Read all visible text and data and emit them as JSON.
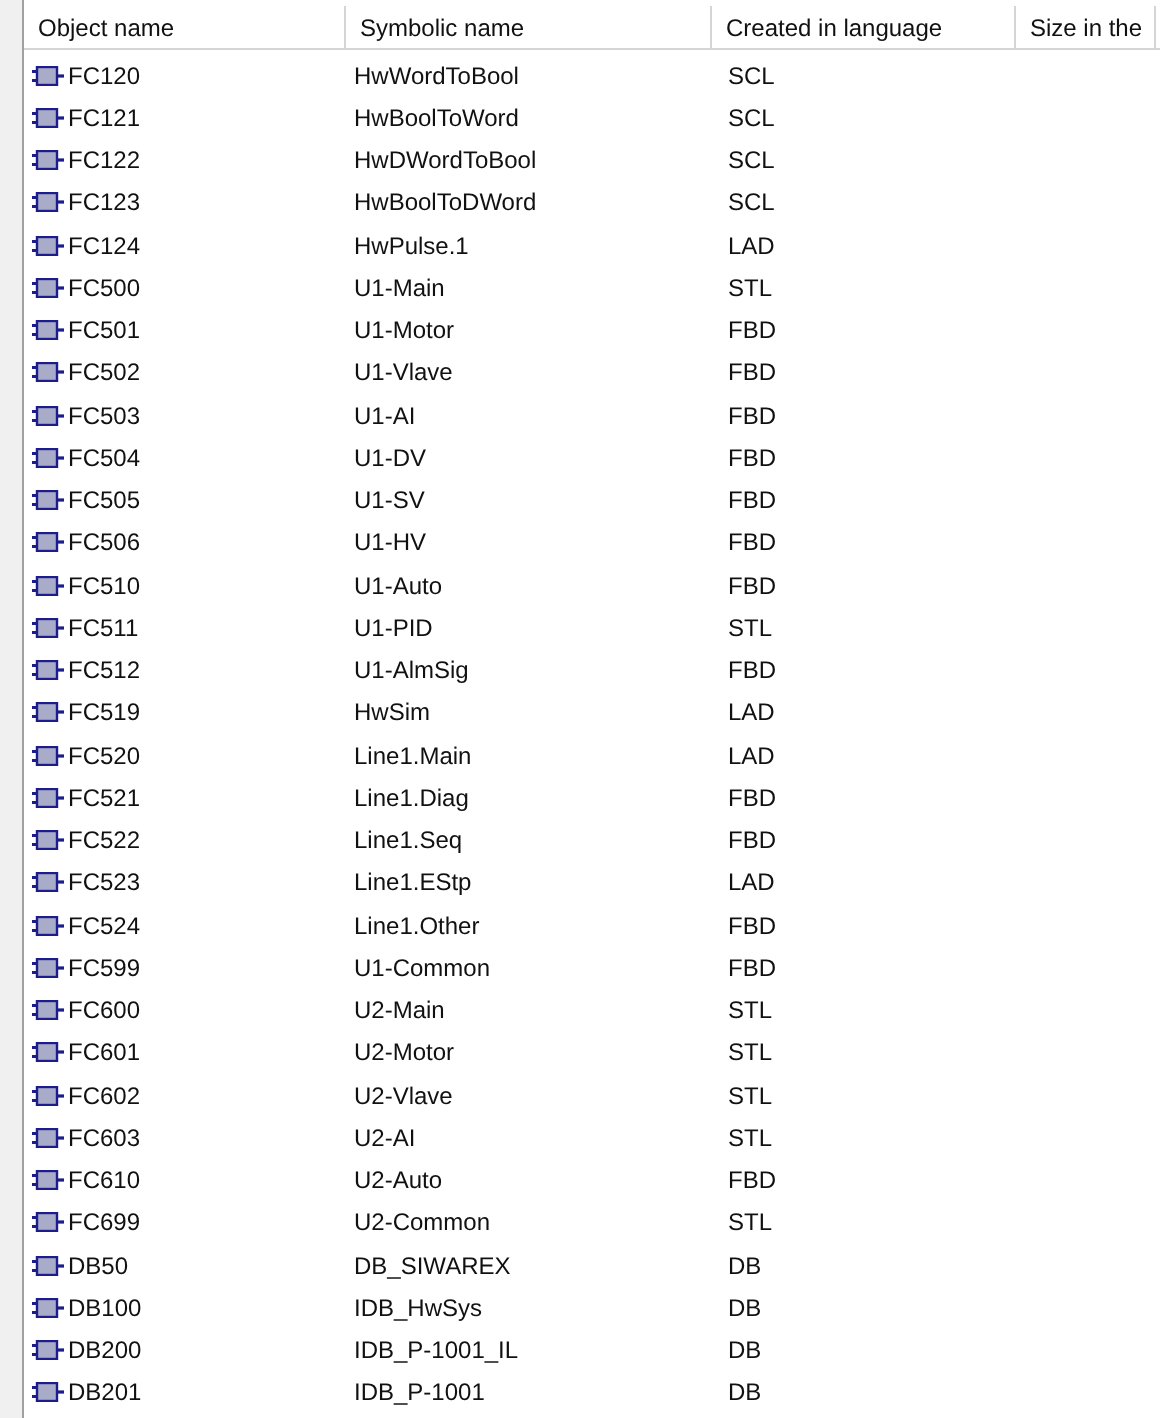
{
  "table": {
    "columns": [
      "Object name",
      "Symbolic name",
      "Created in language",
      "Size in the"
    ],
    "rows": [
      {
        "object_name": "FC120",
        "symbolic_name": "HwWordToBool",
        "language": "SCL"
      },
      {
        "object_name": "FC121",
        "symbolic_name": "HwBoolToWord",
        "language": "SCL"
      },
      {
        "object_name": "FC122",
        "symbolic_name": "HwDWordToBool",
        "language": "SCL"
      },
      {
        "object_name": "FC123",
        "symbolic_name": "HwBoolToDWord",
        "language": "SCL"
      },
      {
        "object_name": "FC124",
        "symbolic_name": "HwPulse.1",
        "language": "LAD"
      },
      {
        "object_name": "FC500",
        "symbolic_name": "U1-Main",
        "language": "STL"
      },
      {
        "object_name": "FC501",
        "symbolic_name": "U1-Motor",
        "language": "FBD"
      },
      {
        "object_name": "FC502",
        "symbolic_name": "U1-Vlave",
        "language": "FBD"
      },
      {
        "object_name": "FC503",
        "symbolic_name": "U1-AI",
        "language": "FBD"
      },
      {
        "object_name": "FC504",
        "symbolic_name": "U1-DV",
        "language": "FBD"
      },
      {
        "object_name": "FC505",
        "symbolic_name": "U1-SV",
        "language": "FBD"
      },
      {
        "object_name": "FC506",
        "symbolic_name": "U1-HV",
        "language": "FBD"
      },
      {
        "object_name": "FC510",
        "symbolic_name": "U1-Auto",
        "language": "FBD"
      },
      {
        "object_name": "FC511",
        "symbolic_name": "U1-PID",
        "language": "STL"
      },
      {
        "object_name": "FC512",
        "symbolic_name": "U1-AlmSig",
        "language": "FBD"
      },
      {
        "object_name": "FC519",
        "symbolic_name": "HwSim",
        "language": "LAD"
      },
      {
        "object_name": "FC520",
        "symbolic_name": "Line1.Main",
        "language": "LAD"
      },
      {
        "object_name": "FC521",
        "symbolic_name": "Line1.Diag",
        "language": "FBD"
      },
      {
        "object_name": "FC522",
        "symbolic_name": "Line1.Seq",
        "language": "FBD"
      },
      {
        "object_name": "FC523",
        "symbolic_name": "Line1.EStp",
        "language": "LAD"
      },
      {
        "object_name": "FC524",
        "symbolic_name": "Line1.Other",
        "language": "FBD"
      },
      {
        "object_name": "FC599",
        "symbolic_name": "U1-Common",
        "language": "FBD"
      },
      {
        "object_name": "FC600",
        "symbolic_name": "U2-Main",
        "language": "STL"
      },
      {
        "object_name": "FC601",
        "symbolic_name": "U2-Motor",
        "language": "STL"
      },
      {
        "object_name": "FC602",
        "symbolic_name": "U2-Vlave",
        "language": "STL"
      },
      {
        "object_name": "FC603",
        "symbolic_name": "U2-AI",
        "language": "STL"
      },
      {
        "object_name": "FC610",
        "symbolic_name": "U2-Auto",
        "language": "FBD"
      },
      {
        "object_name": "FC699",
        "symbolic_name": "U2-Common",
        "language": "STL"
      },
      {
        "object_name": "DB50",
        "symbolic_name": "DB_SIWAREX",
        "language": "DB"
      },
      {
        "object_name": "DB100",
        "symbolic_name": "IDB_HwSys",
        "language": "DB"
      },
      {
        "object_name": "DB200",
        "symbolic_name": "IDB_P-1001_IL",
        "language": "DB"
      },
      {
        "object_name": "DB201",
        "symbolic_name": "IDB_P-1001",
        "language": "DB"
      }
    ]
  }
}
